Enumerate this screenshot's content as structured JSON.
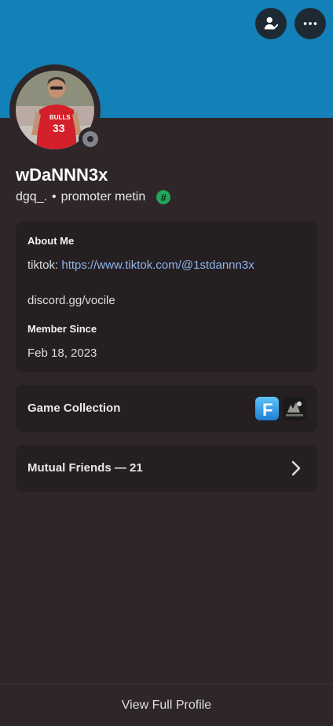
{
  "colors": {
    "banner": "#1380b8",
    "background": "#2f2629",
    "card": "#251f22",
    "link": "#8fb4ea",
    "status_offline": "#82858f",
    "badge_green": "#23a55a"
  },
  "header": {
    "buttons": [
      {
        "icon": "add-friend-icon"
      },
      {
        "icon": "more-options-icon"
      }
    ]
  },
  "profile": {
    "display_name": "wDaNNN3x",
    "username": "dgq_.",
    "separator": "•",
    "pronouns_status": "promoter metin",
    "badge_symbol": "#",
    "status": "offline"
  },
  "about": {
    "heading": "About Me",
    "tiktok_prefix": "tiktok:",
    "tiktok_link": "https://www.tiktok.com/@1stdannn3x",
    "discord_line": "discord.gg/vocile",
    "member_since_heading": "Member Since",
    "member_since_date": "Feb 18, 2023"
  },
  "games": {
    "label": "Game Collection",
    "icons": [
      "fortnite-game-icon",
      "dark-game-icon"
    ],
    "fortnite_letter": "F"
  },
  "mutual": {
    "label": "Mutual Friends — 21"
  },
  "footer": {
    "label": "View Full Profile"
  }
}
